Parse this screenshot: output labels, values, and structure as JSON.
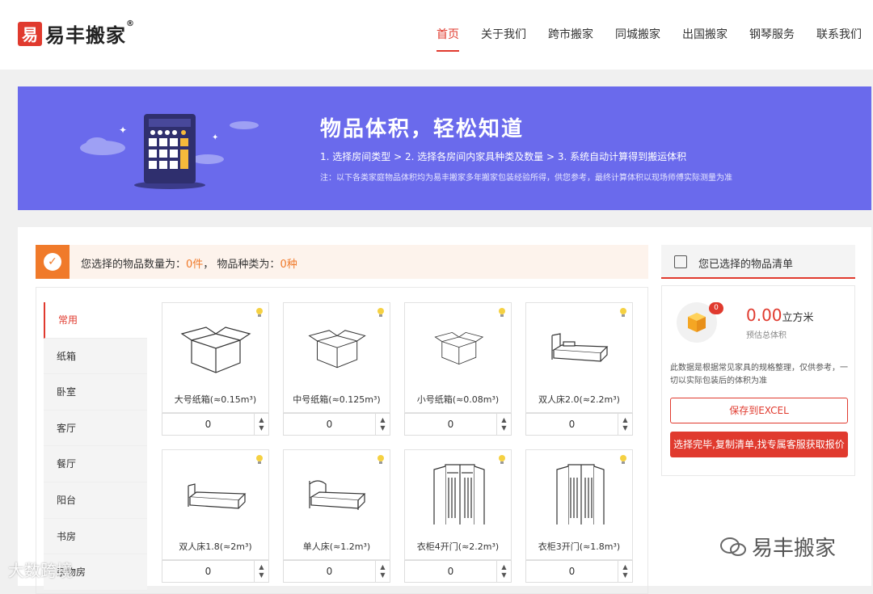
{
  "brand": {
    "logo_mark": "易",
    "name": "易丰搬家",
    "reg": "®"
  },
  "nav": [
    {
      "label": "首页",
      "active": true
    },
    {
      "label": "关于我们"
    },
    {
      "label": "跨市搬家"
    },
    {
      "label": "同城搬家"
    },
    {
      "label": "出国搬家"
    },
    {
      "label": "钢琴服务"
    },
    {
      "label": "联系我们"
    }
  ],
  "banner": {
    "title": "物品体积，轻松知道",
    "steps": "1. 选择房间类型  > 2. 选择各房间内家具种类及数量  > 3. 系统自动计算得到搬运体积",
    "note": "注：以下各类家庭物品体积均为易丰搬家多年搬家包装经验所得，供您参考，最终计算体积以现场师傅实际测量为准"
  },
  "summary": {
    "prefix": "您选择的物品数量为：",
    "count": "0件",
    "middle": "，  物品种类为：",
    "kinds": "0种"
  },
  "categories": [
    {
      "label": "常用",
      "active": true
    },
    {
      "label": "纸箱"
    },
    {
      "label": "卧室"
    },
    {
      "label": "客厅"
    },
    {
      "label": "餐厅"
    },
    {
      "label": "阳台"
    },
    {
      "label": "书房"
    },
    {
      "label": "杂物房"
    }
  ],
  "items": [
    {
      "name": "大号纸箱(≈0.15m³)",
      "qty": "0",
      "icon": "box-icon"
    },
    {
      "name": "中号纸箱(≈0.125m³)",
      "qty": "0",
      "icon": "box-icon"
    },
    {
      "name": "小号纸箱(≈0.08m³)",
      "qty": "0",
      "icon": "box-icon"
    },
    {
      "name": "双人床2.0(≈2.2m³)",
      "qty": "0",
      "icon": "bed-icon"
    },
    {
      "name": "双人床1.8(≈2m³)",
      "qty": "0",
      "icon": "bed-icon"
    },
    {
      "name": "单人床(≈1.2m³)",
      "qty": "0",
      "icon": "bed-icon"
    },
    {
      "name": "衣柜4开门(≈2.2m³)",
      "qty": "0",
      "icon": "wardrobe-icon"
    },
    {
      "name": "衣柜3开门(≈1.8m³)",
      "qty": "0",
      "icon": "wardrobe-icon"
    }
  ],
  "list_panel": {
    "title": "您已选择的物品清单",
    "badge": "0",
    "volume": "0.00",
    "unit": "立方米",
    "volume_label": "预估总体积",
    "note": "此数据是根据常见家具的规格整理，仅供参考，一切以实际包装后的体积为准",
    "excel_button": "保存到EXCEL",
    "quote_button": "选择完毕,复制清单,找专属客服获取报价"
  },
  "watermarks": {
    "left": "大数跨境",
    "right": "易丰搬家"
  },
  "colors": {
    "accent": "#e03a2e",
    "banner": "#6a6aec",
    "orange": "#f07a2a"
  }
}
